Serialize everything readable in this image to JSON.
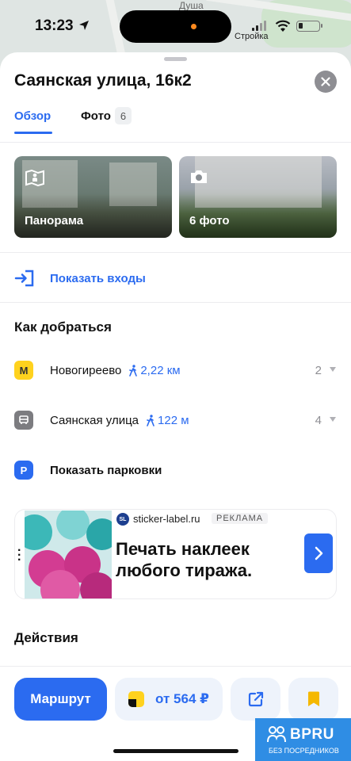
{
  "map": {
    "street_label": "Душа"
  },
  "status_bar": {
    "time": "13:23",
    "carrier": "Стройка"
  },
  "place": {
    "title": "Саянская улица, 16к2",
    "tabs": [
      {
        "label": "Обзор",
        "active": true
      },
      {
        "label": "Фото",
        "badge": "6"
      }
    ],
    "media": [
      {
        "label": "Панорама",
        "icon": "panorama-icon"
      },
      {
        "label": "6 фото",
        "icon": "camera-icon"
      }
    ],
    "show_entrances": "Показать входы"
  },
  "directions": {
    "title": "Как добраться",
    "stops": [
      {
        "type": "metro",
        "badge": "М",
        "name": "Новогиреево",
        "distance": "2,22 км",
        "count": "2"
      },
      {
        "type": "bus",
        "name": "Саянская улица",
        "distance": "122 м",
        "count": "4"
      }
    ],
    "show_parking": "Показать парковки",
    "parking_badge": "P"
  },
  "ad": {
    "logo_text": "SL",
    "domain": "sticker-label.ru",
    "tag": "РЕКЛАМА",
    "headline": "Печать наклеек любого тиража."
  },
  "actions": {
    "title": "Действия",
    "route_label": "Маршрут",
    "taxi_label": "от 564 ₽"
  },
  "watermark": {
    "title": "BPRU",
    "subtitle": "БЕЗ ПОСРЕДНИКОВ"
  },
  "colors": {
    "accent": "#2b6bf0",
    "metro": "#ffd21e",
    "close_button": "#8e8e93"
  }
}
